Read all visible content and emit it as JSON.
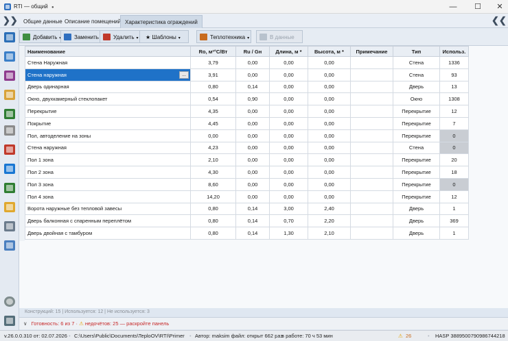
{
  "window": {
    "title": "RTI — общий",
    "dot": "●",
    "minimize": "—",
    "maximize": "☐",
    "close": "✕"
  },
  "tabs": [
    {
      "label": "Общие данные"
    },
    {
      "label": "Описание помещений"
    },
    {
      "label": "Характеристика ограждений"
    }
  ],
  "nav": {
    "left": "❯❯",
    "right": "❮❮"
  },
  "toolbar": {
    "add": "Добавить",
    "replace": "Заменить",
    "delete": "Удалить",
    "templates": "★ Шаблоны",
    "thermal": "Теплотехника",
    "to_data": "В данные",
    "caret": "▾"
  },
  "table": {
    "columns": [
      "Наименование",
      "Ro, м²°С/Вт",
      "Ru / Gн",
      "Длина, м *",
      "Высота, м *",
      "Примечание",
      "Тип",
      "Использ."
    ],
    "rows": [
      [
        "Стена Наружная",
        "3,79",
        "0,00",
        "0,00",
        "0,00",
        "",
        "Стена",
        "1336"
      ],
      [
        "Стена наружная",
        "3,91",
        "0,00",
        "0,00",
        "0,00",
        "",
        "Стена",
        "93"
      ],
      [
        "Дверь одинарная",
        "0,80",
        "0,14",
        "0,00",
        "0,00",
        "",
        "Дверь",
        "13"
      ],
      [
        "Окно, двухкамерный стеклопакет",
        "0,54",
        "0,90",
        "0,00",
        "0,00",
        "",
        "Окно",
        "1308"
      ],
      [
        "Перекрытие",
        "4,35",
        "0,00",
        "0,00",
        "0,00",
        "",
        "Перекрытие",
        "12"
      ],
      [
        "Покрытие",
        "4,45",
        "0,00",
        "0,00",
        "0,00",
        "",
        "Перекрытие",
        "7"
      ],
      [
        "Пол, автоделение на зоны",
        "0,00",
        "0,00",
        "0,00",
        "0,00",
        "",
        "Перекрытие",
        "0"
      ],
      [
        "Стена наружная",
        "4,23",
        "0,00",
        "0,00",
        "0,00",
        "",
        "Стена",
        "0"
      ],
      [
        "Пол 1 зона",
        "2,10",
        "0,00",
        "0,00",
        "0,00",
        "",
        "Перекрытие",
        "20"
      ],
      [
        "Пол 2 зона",
        "4,30",
        "0,00",
        "0,00",
        "0,00",
        "",
        "Перекрытие",
        "18"
      ],
      [
        "Пол 3 зона",
        "8,60",
        "0,00",
        "0,00",
        "0,00",
        "",
        "Перекрытие",
        "0"
      ],
      [
        "Пол 4 зона",
        "14,20",
        "0,00",
        "0,00",
        "0,00",
        "",
        "Перекрытие",
        "12"
      ],
      [
        "Ворота наружные без тепловой завесы",
        "0,80",
        "0,14",
        "3,00",
        "2,40",
        "",
        "Дверь",
        "1"
      ],
      [
        "Дверь балконная с спаренным переплётом",
        "0,80",
        "0,14",
        "0,70",
        "2,20",
        "",
        "Дверь",
        "369"
      ],
      [
        "Дверь двойная с тамбуром",
        "0,80",
        "0,14",
        "1,30",
        "2,10",
        "",
        "Дверь",
        "1"
      ]
    ],
    "selected_row": 1,
    "unused_rows": [
      6,
      7,
      10
    ],
    "ellipsis": "..."
  },
  "summary": "Конструкций: 15   |   Используется: 12   |   Не используется: 3",
  "warning": {
    "chevron": "∨",
    "text": "Готовность: 6 из 7 ·",
    "icon": "⚠",
    "text2": "недочётов: 25 — раскройте панель"
  },
  "status": {
    "version": "v.26.0.0.310 от: 02.07.2026",
    "path": "C:\\Users\\Public\\Documents\\TeploOV\\RTI\\Primer",
    "author": "Автор: maksim файл: открыт 662 раз",
    "work": "в работе: 70 ч 53 мин",
    "warn_icon": "⚠",
    "warn_count": "26",
    "hasp": "HASP 3889500790986744218"
  },
  "colors": {
    "accent": "#1f72c8",
    "sidebar_icons": [
      "#2c6fb7",
      "#3b7fc8",
      "#8e3b8e",
      "#d8a23a",
      "#2e7d32",
      "#8b8b8b",
      "#c0392b",
      "#1976d2",
      "#2e7d32",
      "#e0a82e",
      "#6b7b8c",
      "#4a7fbf",
      "#7f8c8d",
      "#546e7a"
    ]
  }
}
